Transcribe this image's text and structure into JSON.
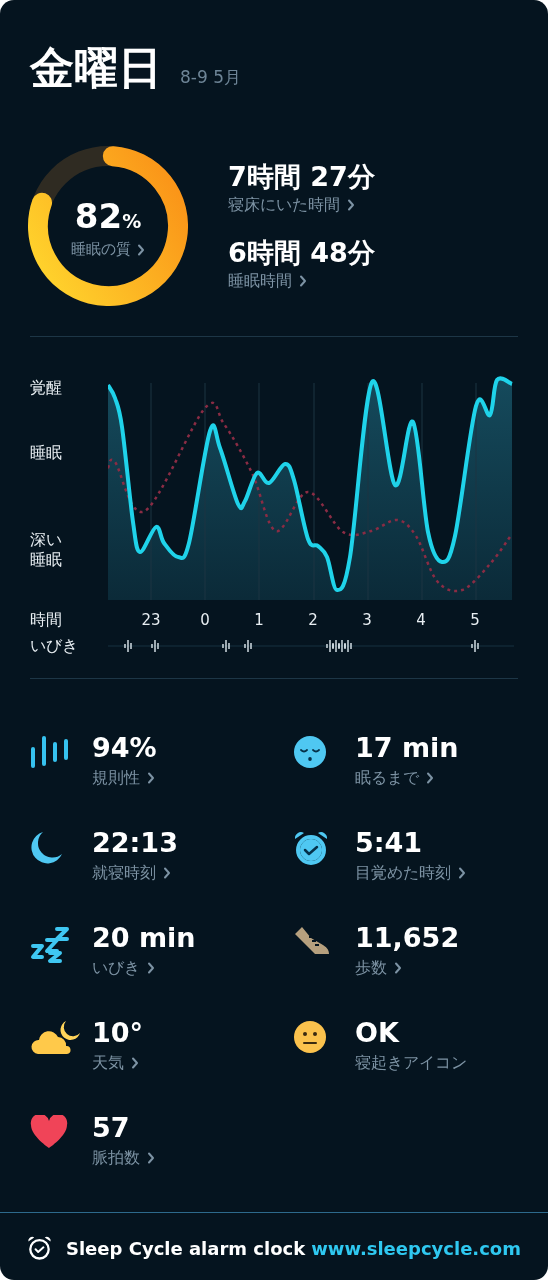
{
  "header": {
    "title": "金曜日",
    "date": "8-9 5月"
  },
  "summary": {
    "quality": {
      "value": "82",
      "unit": "%",
      "label": "睡眠の質"
    },
    "durations": [
      {
        "value": "7時間 27分",
        "label": "寝床にいた時間"
      },
      {
        "value": "6時間 48分",
        "label": "睡眠時間"
      }
    ]
  },
  "graph": {
    "stage_labels": [
      "覚醒",
      "睡眠",
      "深い睡眠"
    ],
    "time_label": "時間",
    "hours": [
      "23",
      "0",
      "1",
      "2",
      "3",
      "4",
      "5"
    ],
    "snore_label": "いびき"
  },
  "stats": [
    {
      "kind": "bars",
      "value": "94%",
      "label": "規則性",
      "link": true
    },
    {
      "kind": "sleepy",
      "value": "17 min",
      "label": "眠るまで",
      "link": true
    },
    {
      "kind": "moon",
      "value": "22:13",
      "label": "就寝時刻",
      "link": true
    },
    {
      "kind": "alarm",
      "value": "5:41",
      "label": "目覚めた時刻",
      "link": true
    },
    {
      "kind": "zzz",
      "value": "20 min",
      "label": "いびき",
      "link": true
    },
    {
      "kind": "shoe",
      "value": "11,652",
      "label": "歩数",
      "link": true
    },
    {
      "kind": "weather",
      "value": "10°",
      "label": "天気",
      "link": true
    },
    {
      "kind": "mood",
      "value": "OK",
      "label": "寝起きアイコン",
      "link": false
    },
    {
      "kind": "heart",
      "value": "57",
      "label": "脈拍数",
      "link": true
    }
  ],
  "footer": {
    "text": "Sleep Cycle alarm clock",
    "url": "www.sleepcycle.com"
  }
}
